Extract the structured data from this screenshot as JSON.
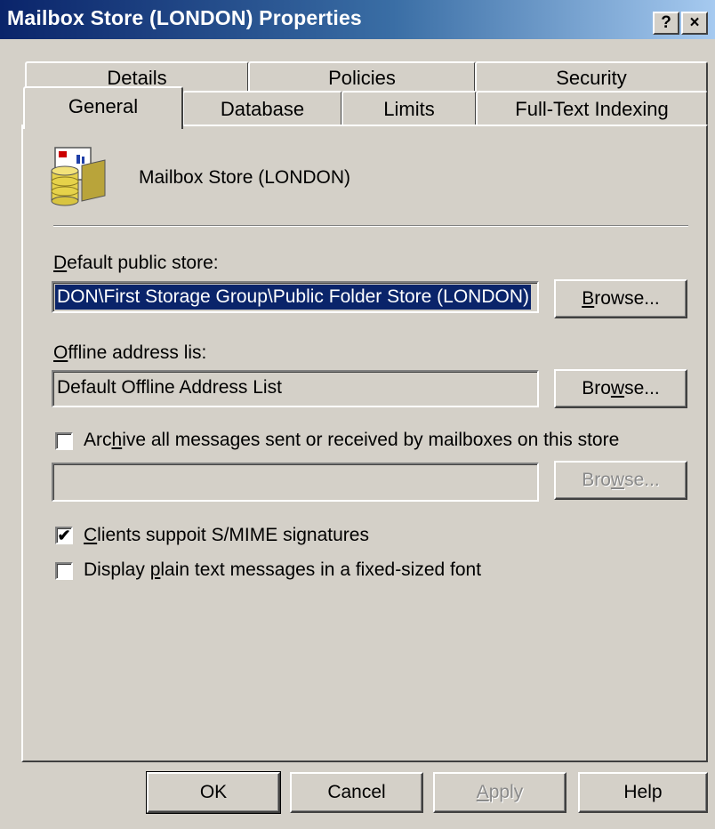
{
  "window": {
    "title": "Mailbox Store (LONDON) Properties",
    "help_button": "?",
    "close_button": "×"
  },
  "tabs": {
    "back_row": [
      "Details",
      "Policies",
      "Security"
    ],
    "front_row": [
      "General",
      "Database",
      "Limits",
      "Full-Text Indexing"
    ],
    "selected": "General"
  },
  "general": {
    "store_name": "Mailbox Store (LONDON)",
    "store_icon": "mailbox-store-icon",
    "default_public_store": {
      "label": "Default public store:",
      "value": "DON\\First Storage Group\\Public Folder Store (LONDON)",
      "browse_label": "Browse..."
    },
    "offline_address_list": {
      "label": "Offline address lis:",
      "value": "Default Offline Address List",
      "browse_label": "Browse..."
    },
    "archive": {
      "label": "Archive all messages sent or received by mailboxes on this store",
      "checked": false,
      "value": "",
      "browse_label": "Browse..."
    },
    "smime": {
      "label": "Clients suppoit S/MIME signatures",
      "checked": true
    },
    "plain_text": {
      "label": "Display plain text messages in a fixed-sized font",
      "checked": false
    }
  },
  "footer": {
    "ok": "OK",
    "cancel": "Cancel",
    "apply": "Apply",
    "help": "Help"
  }
}
